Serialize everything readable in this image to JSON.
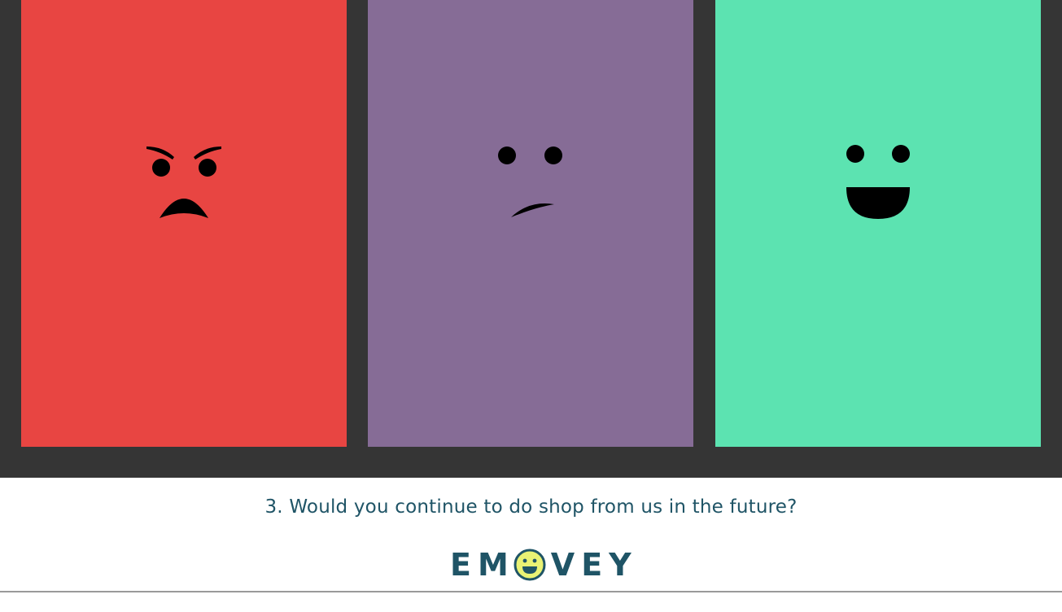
{
  "survey": {
    "question": "3. Would you continue to do shop from us in the future?",
    "options": [
      {
        "mood": "angry",
        "icon": "angry-face-icon",
        "color": "#e84542"
      },
      {
        "mood": "neutral",
        "icon": "unsure-face-icon",
        "color": "#866c96"
      },
      {
        "mood": "happy",
        "icon": "happy-face-icon",
        "color": "#5ce3b1"
      }
    ]
  },
  "brand": {
    "logo_left": "EM",
    "logo_right": "VEY",
    "logo_color": "#1f5466",
    "logo_face_color": "#e9f274"
  },
  "colors": {
    "background": "#353535",
    "text": "#1f5466"
  }
}
